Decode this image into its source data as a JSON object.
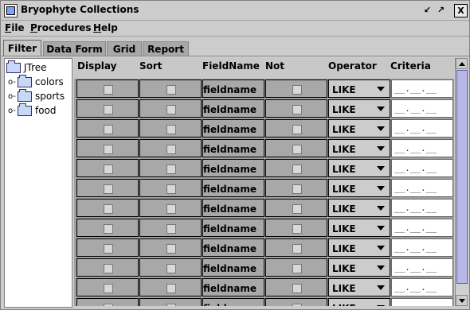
{
  "window": {
    "title": "Bryophyte Collections"
  },
  "titlebar": {
    "minimize_icon": "minimize-icon",
    "maximize_icon": "maximize-icon",
    "close_label": "X"
  },
  "menu": [
    "File",
    "Procedures",
    "Help"
  ],
  "tabs": [
    "Filter",
    "Data Form",
    "Grid",
    "Report"
  ],
  "active_tab": "Filter",
  "tree": {
    "root": "JTree",
    "children": [
      "colors",
      "sports",
      "food"
    ]
  },
  "grid": {
    "columns": [
      "Display",
      "Sort",
      "FieldName",
      "Not",
      "Operator",
      "Criteria"
    ],
    "rows": [
      {
        "field": "fieldname",
        "operator": "LIKE",
        "criteria": "__.__.__"
      },
      {
        "field": "fieldname",
        "operator": "LIKE",
        "criteria": "__.__.__"
      },
      {
        "field": "fieldname",
        "operator": "LIKE",
        "criteria": "__.__.__"
      },
      {
        "field": "fieldname",
        "operator": "LIKE",
        "criteria": "__.__.__"
      },
      {
        "field": "fieldname",
        "operator": "LIKE",
        "criteria": "__.__.__"
      },
      {
        "field": "fieldname",
        "operator": "LIKE",
        "criteria": "__.__.__"
      },
      {
        "field": "fieldname",
        "operator": "LIKE",
        "criteria": "__.__.__"
      },
      {
        "field": "fieldname",
        "operator": "LIKE",
        "criteria": "__.__.__"
      },
      {
        "field": "fieldname",
        "operator": "LIKE",
        "criteria": "__.__.__"
      },
      {
        "field": "fieldname",
        "operator": "LIKE",
        "criteria": "__.__.__"
      },
      {
        "field": "fieldname",
        "operator": "LIKE",
        "criteria": "__.__.__"
      },
      {
        "field": "fieldname",
        "operator": "LIKE",
        "criteria": "__.__.__"
      }
    ]
  }
}
